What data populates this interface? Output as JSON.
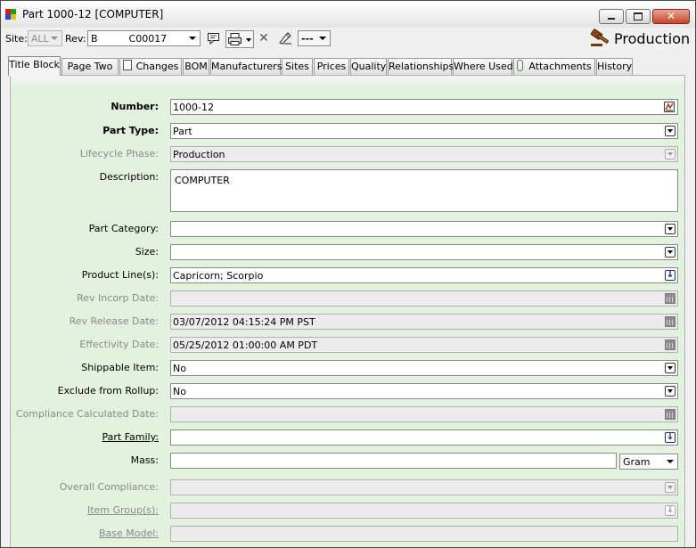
{
  "window": {
    "title": "Part  1000-12 [COMPUTER]",
    "buttons": {
      "minimize": "minimize-icon",
      "maximize": "maximize-icon",
      "close": "close-icon"
    }
  },
  "toolbar": {
    "site_label": "Site:",
    "site_value": "ALL",
    "rev_label": "Rev:",
    "rev_value": "B          C00017",
    "more_value": "---",
    "lifecycle_badge": "Production",
    "icons": [
      "comment-icon",
      "print-icon",
      "delete-icon",
      "redline-icon",
      "more-actions-icon",
      "gavel-icon"
    ]
  },
  "tabs": [
    {
      "label": "Title Block",
      "active": true
    },
    {
      "label": "Page Two"
    },
    {
      "label": "Changes",
      "icon": "document-icon"
    },
    {
      "label": "BOM"
    },
    {
      "label": "Manufacturers"
    },
    {
      "label": "Sites"
    },
    {
      "label": "Prices"
    },
    {
      "label": "Quality"
    },
    {
      "label": "Relationships"
    },
    {
      "label": "Where Used"
    },
    {
      "label": "Attachments",
      "icon": "paperclip-icon"
    },
    {
      "label": "History"
    }
  ],
  "fields": {
    "number": {
      "label": "Number:",
      "value": "1000-12"
    },
    "part_type": {
      "label": "Part Type:",
      "value": "Part"
    },
    "lifecycle_phase": {
      "label": "Lifecycle Phase:",
      "value": "Production"
    },
    "description": {
      "label": "Description:",
      "value": "COMPUTER"
    },
    "part_category": {
      "label": "Part Category:",
      "value": ""
    },
    "size": {
      "label": "Size:",
      "value": ""
    },
    "product_lines": {
      "label": "Product Line(s):",
      "value": "Capricorn; Scorpio"
    },
    "rev_incorp_date": {
      "label": "Rev Incorp Date:",
      "value": ""
    },
    "rev_release_date": {
      "label": "Rev Release Date:",
      "value": "03/07/2012 04:15:24 PM PST"
    },
    "effectivity_date": {
      "label": "Effectivity Date:",
      "value": "05/25/2012 01:00:00 AM PDT"
    },
    "shippable_item": {
      "label": "Shippable Item:",
      "value": "No"
    },
    "exclude_from_rollup": {
      "label": "Exclude from Rollup:",
      "value": "No"
    },
    "compliance_calculated_date": {
      "label": "Compliance Calculated Date:",
      "value": ""
    },
    "part_family": {
      "label": "Part Family:",
      "value": ""
    },
    "mass": {
      "label": "Mass:",
      "value": "",
      "unit": "Gram"
    },
    "overall_compliance": {
      "label": "Overall Compliance:",
      "value": ""
    },
    "item_groups": {
      "label": "Item Group(s):",
      "value": ""
    },
    "base_model": {
      "label": "Base Model:",
      "value": ""
    }
  },
  "colors": {
    "panel_background": "#e3f1df",
    "field_background": "#ffffff",
    "readonly_field_background": "#ececec",
    "dim_label": "#8a8a8a"
  }
}
